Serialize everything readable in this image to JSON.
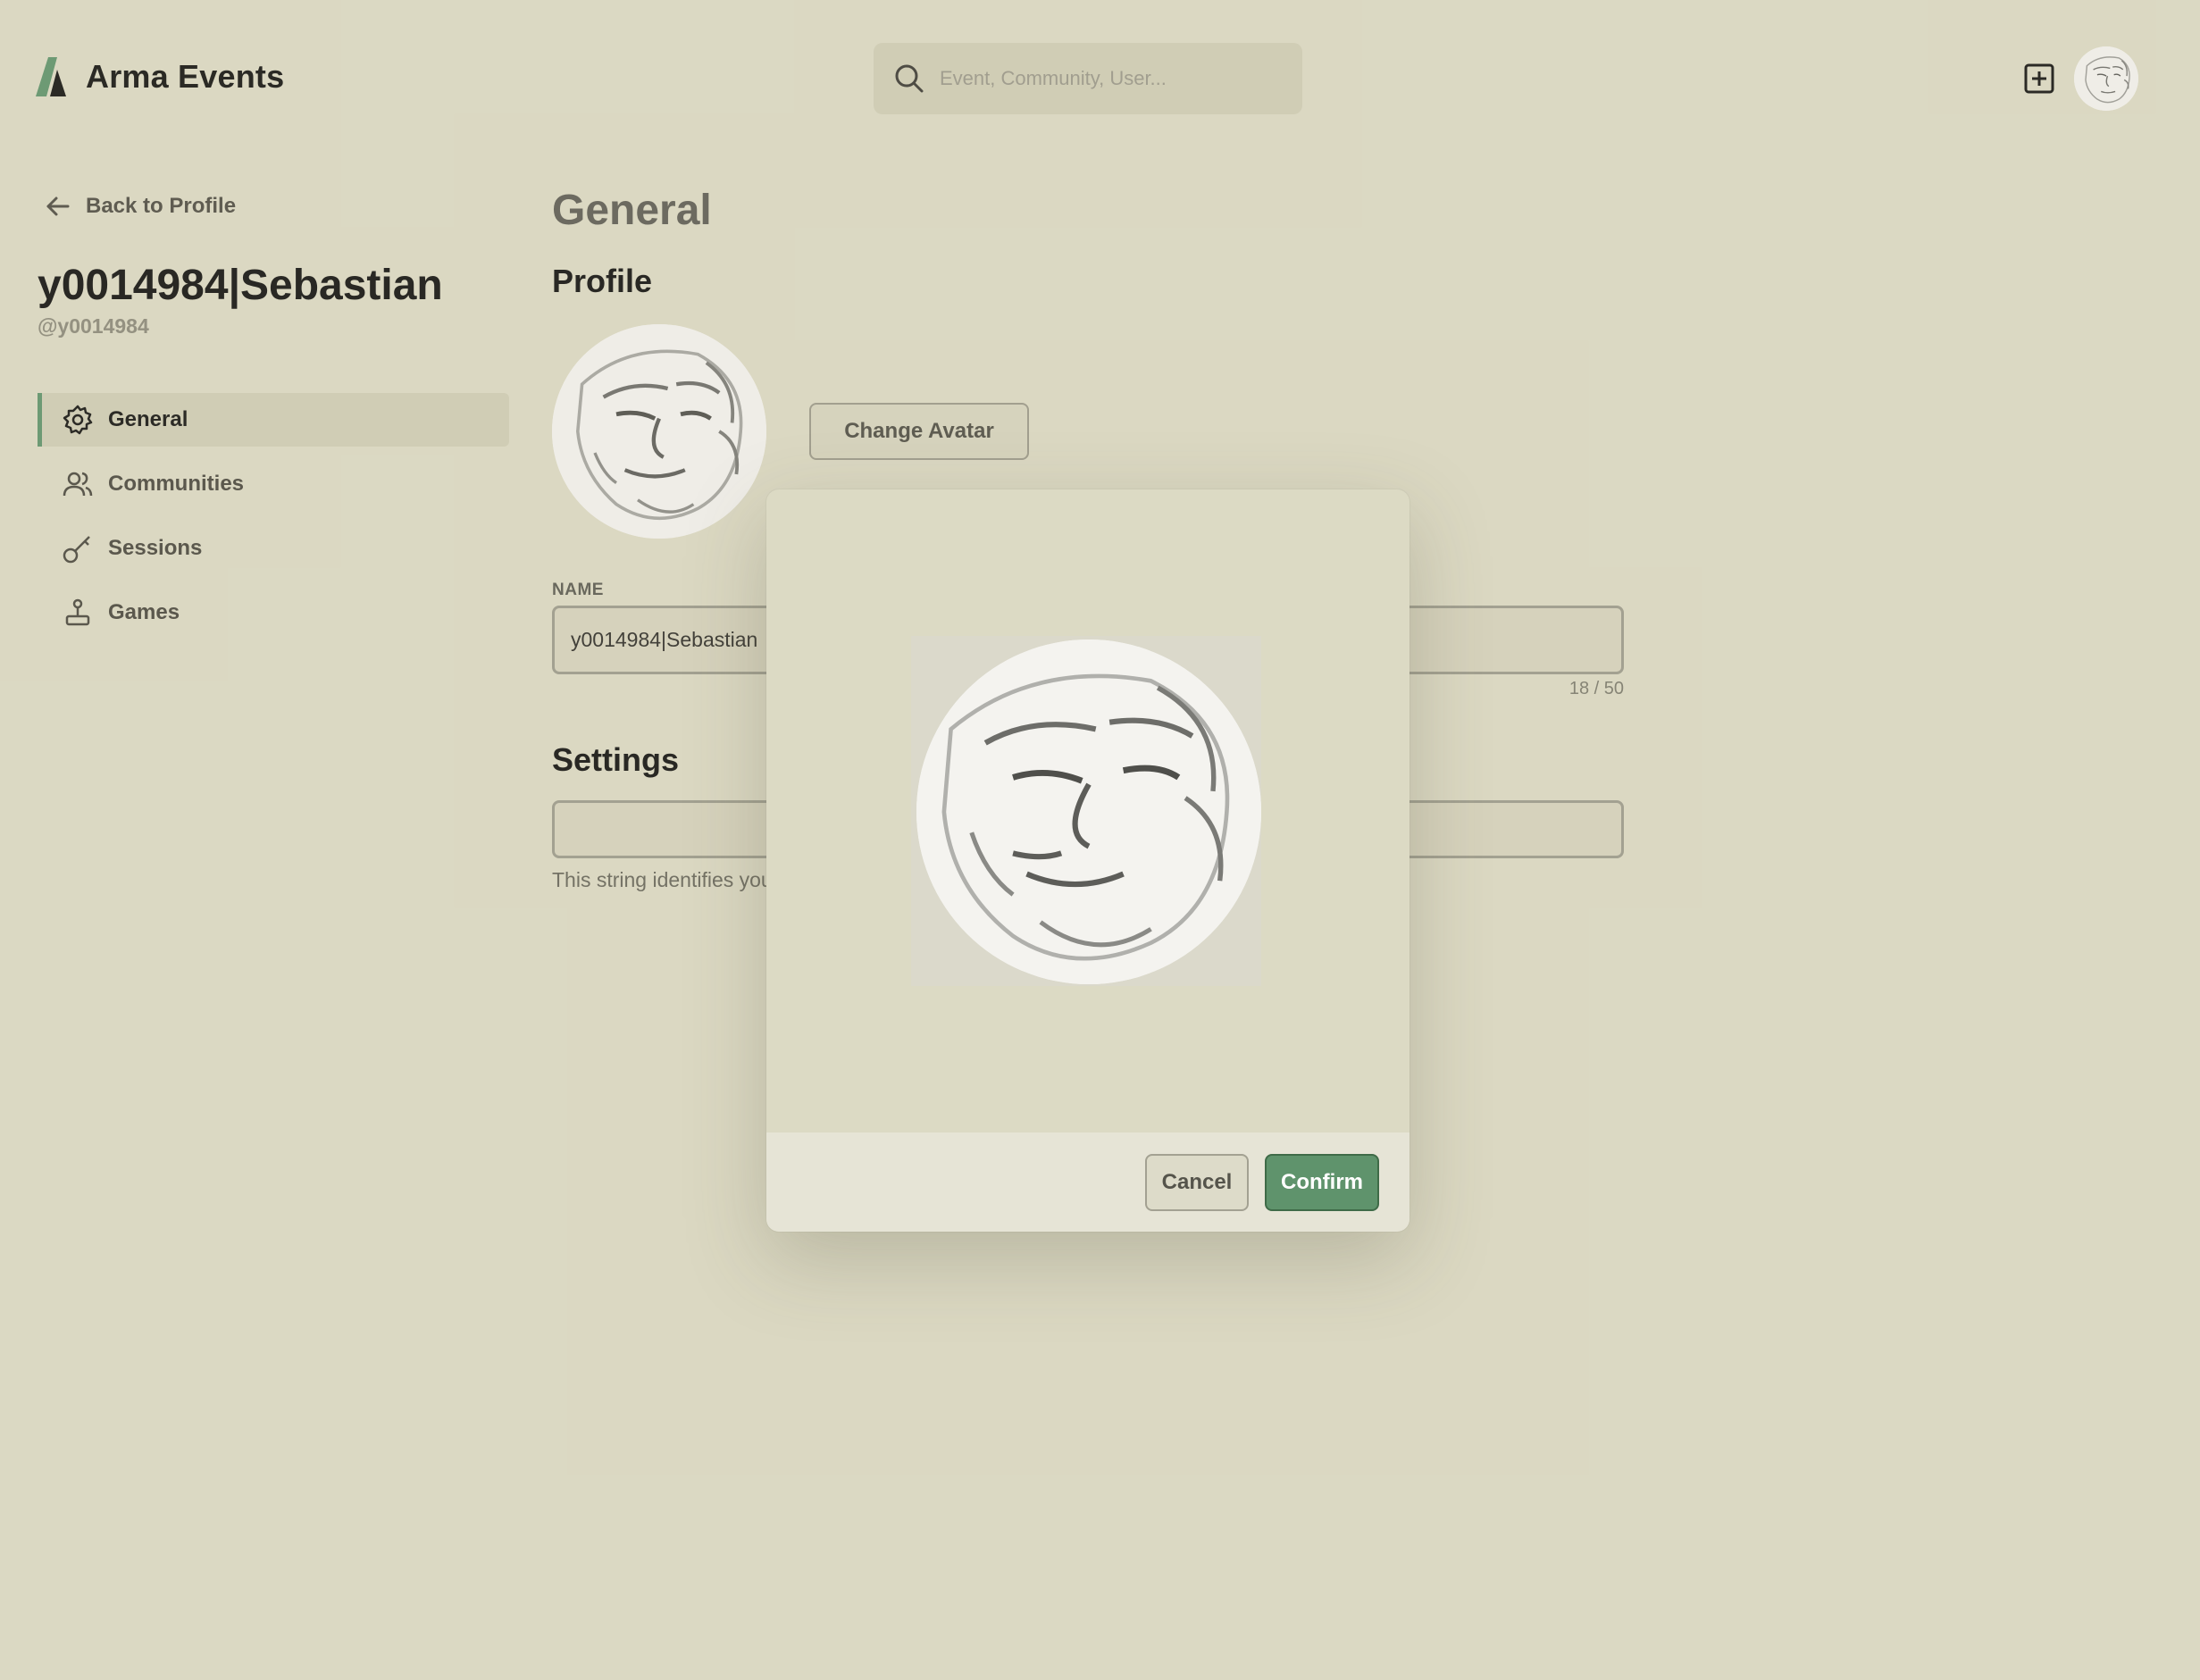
{
  "app": {
    "name": "Arma Events"
  },
  "search": {
    "placeholder": "Event, Community, User..."
  },
  "sidebar": {
    "back_label": "Back to Profile",
    "display_name": "y0014984|Sebastian",
    "handle": "@y0014984",
    "items": [
      {
        "label": "General",
        "icon": "gear-icon",
        "active": true
      },
      {
        "label": "Communities",
        "icon": "users-icon",
        "active": false
      },
      {
        "label": "Sessions",
        "icon": "key-icon",
        "active": false
      },
      {
        "label": "Games",
        "icon": "joystick-icon",
        "active": false
      }
    ]
  },
  "main": {
    "title": "General",
    "profile_heading": "Profile",
    "change_avatar_label": "Change Avatar",
    "name_label": "NAME",
    "name_value": "y0014984|Sebastian",
    "name_counter": "18 / 50",
    "settings_heading": "Settings",
    "settings_help": "This string identifies you"
  },
  "modal": {
    "cancel_label": "Cancel",
    "confirm_label": "Confirm"
  },
  "colors": {
    "background": "#dcdac4",
    "accent": "#5f936c",
    "panel": "#d0cdb6"
  }
}
